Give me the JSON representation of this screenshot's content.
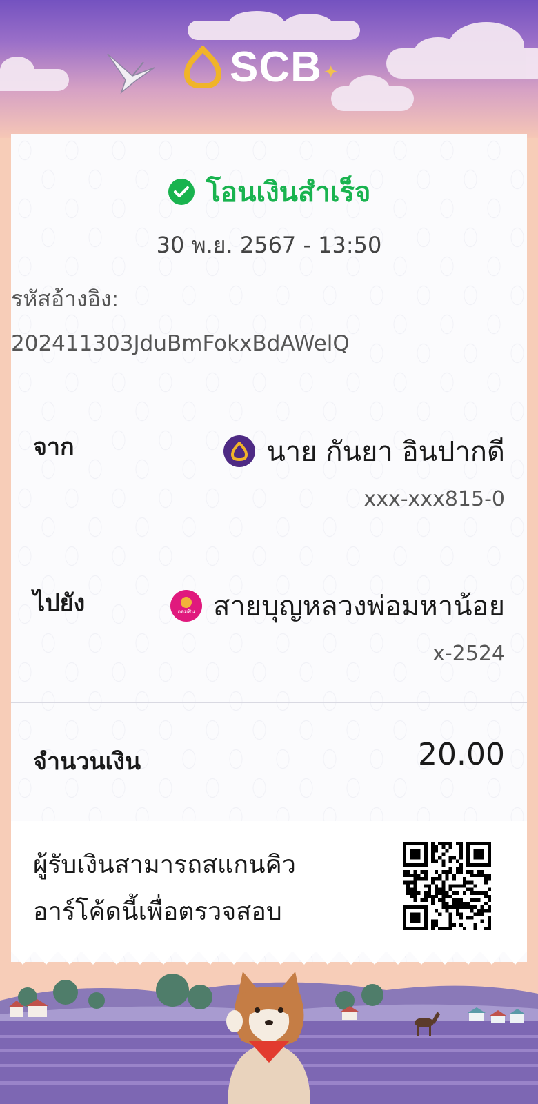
{
  "brand": {
    "name": "SCB"
  },
  "receipt": {
    "status": "โอนเงินสำเร็จ",
    "datetime": "30 พ.ย. 2567 - 13:50",
    "ref_label": "รหัสอ้างอิง:",
    "ref_value": "202411303JduBmFokxBdAWelQ"
  },
  "from": {
    "label": "จาก",
    "name": "นาย กันยา อินปากดี",
    "account": "xxx-xxx815-0"
  },
  "to": {
    "label": "ไปยัง",
    "name": "สายบุญหลวงพ่อมหาน้อย",
    "account": "x-2524",
    "bank_icon_text": "ออมสิน"
  },
  "amount": {
    "label": "จำนวนเงิน",
    "value": "20.00"
  },
  "qr": {
    "text_line1": "ผู้รับเงินสามารถสแกนคิว",
    "text_line2": "อาร์โค้ดนี้เพื่อตรวจสอบ"
  },
  "colors": {
    "success": "#19b34f",
    "scb_purple": "#4e2a84",
    "gsb_pink": "#e0197d",
    "background": "#f7cdb8"
  }
}
